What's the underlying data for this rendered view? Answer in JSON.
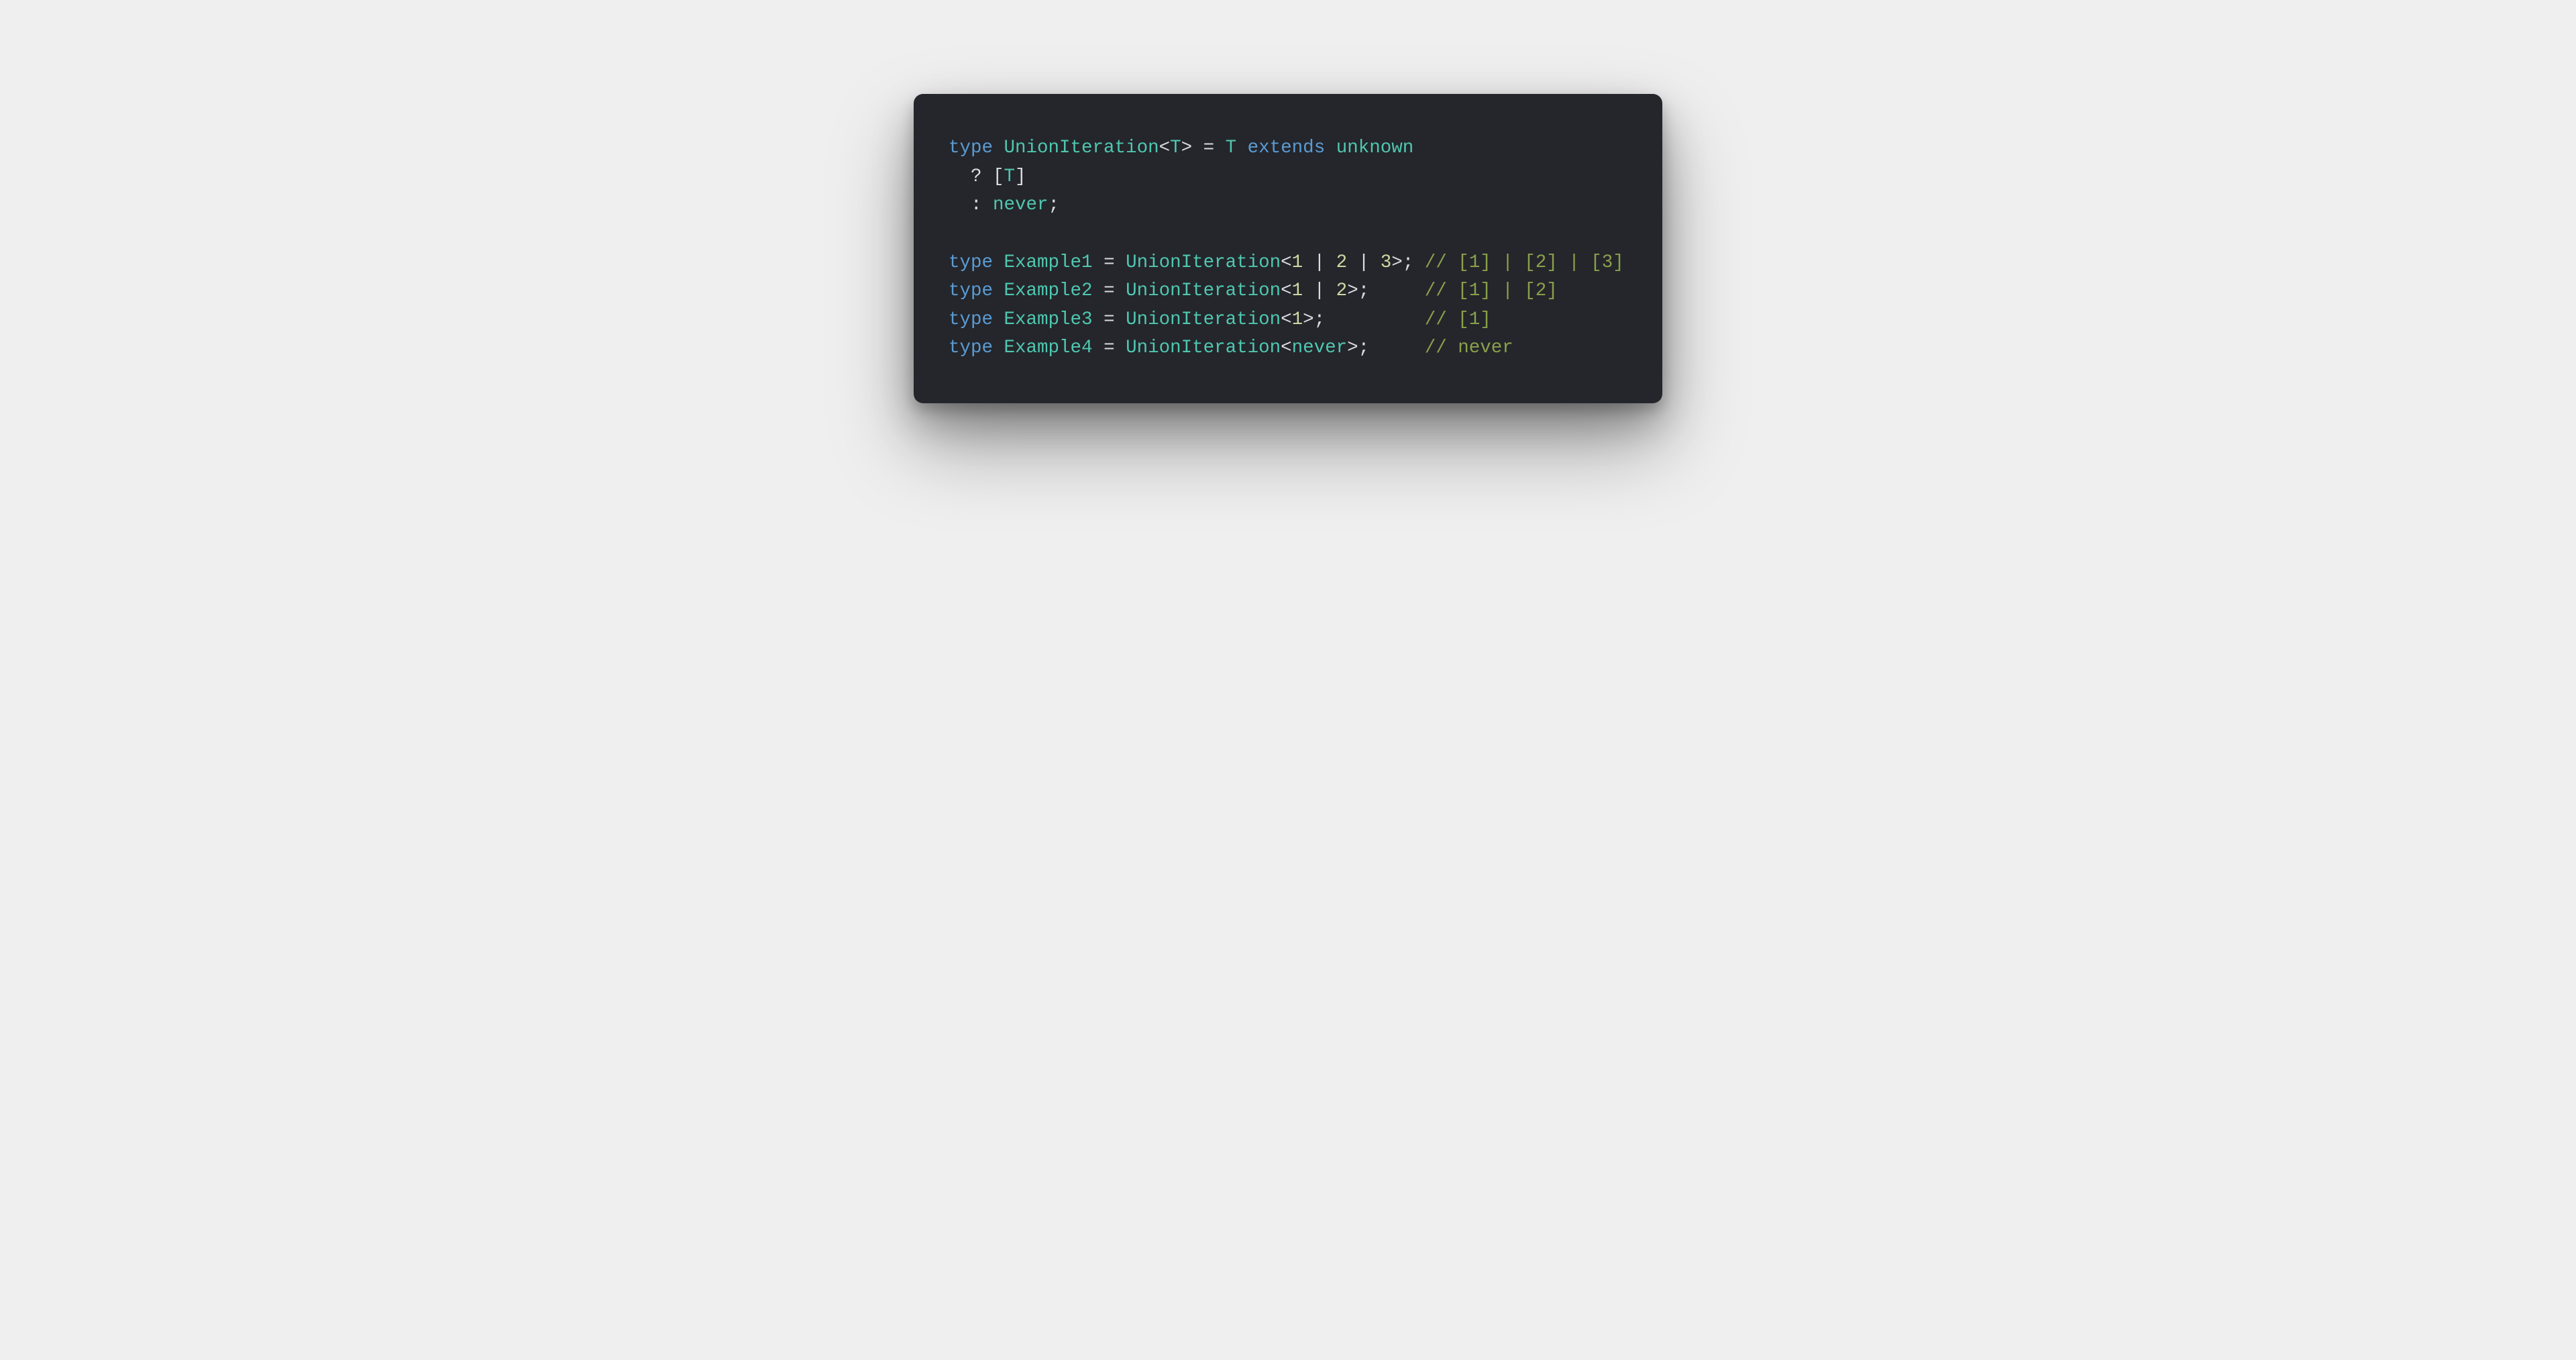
{
  "code": {
    "tokens": [
      [
        {
          "t": "type",
          "c": "tok-keyword"
        },
        {
          "t": " ",
          "c": "tok-punct"
        },
        {
          "t": "UnionIteration",
          "c": "tok-typename"
        },
        {
          "t": "<",
          "c": "tok-punct"
        },
        {
          "t": "T",
          "c": "tok-typename"
        },
        {
          "t": ">",
          "c": "tok-punct"
        },
        {
          "t": " = ",
          "c": "tok-punct"
        },
        {
          "t": "T",
          "c": "tok-typename"
        },
        {
          "t": " ",
          "c": "tok-punct"
        },
        {
          "t": "extends",
          "c": "tok-keyword"
        },
        {
          "t": " ",
          "c": "tok-punct"
        },
        {
          "t": "unknown",
          "c": "tok-typename"
        }
      ],
      [
        {
          "t": "  ? [",
          "c": "tok-punct"
        },
        {
          "t": "T",
          "c": "tok-typename"
        },
        {
          "t": "]",
          "c": "tok-punct"
        }
      ],
      [
        {
          "t": "  : ",
          "c": "tok-punct"
        },
        {
          "t": "never",
          "c": "tok-typename"
        },
        {
          "t": ";",
          "c": "tok-punct"
        }
      ],
      [],
      [
        {
          "t": "type",
          "c": "tok-keyword"
        },
        {
          "t": " ",
          "c": "tok-punct"
        },
        {
          "t": "Example1",
          "c": "tok-typename"
        },
        {
          "t": " = ",
          "c": "tok-punct"
        },
        {
          "t": "UnionIteration",
          "c": "tok-typename"
        },
        {
          "t": "<",
          "c": "tok-punct"
        },
        {
          "t": "1",
          "c": "tok-number"
        },
        {
          "t": " | ",
          "c": "tok-punct"
        },
        {
          "t": "2",
          "c": "tok-number"
        },
        {
          "t": " | ",
          "c": "tok-punct"
        },
        {
          "t": "3",
          "c": "tok-number"
        },
        {
          "t": ">;",
          "c": "tok-punct"
        },
        {
          "t": " ",
          "c": "tok-punct"
        },
        {
          "t": "// [1] | [2] | [3]",
          "c": "tok-comment"
        }
      ],
      [
        {
          "t": "type",
          "c": "tok-keyword"
        },
        {
          "t": " ",
          "c": "tok-punct"
        },
        {
          "t": "Example2",
          "c": "tok-typename"
        },
        {
          "t": " = ",
          "c": "tok-punct"
        },
        {
          "t": "UnionIteration",
          "c": "tok-typename"
        },
        {
          "t": "<",
          "c": "tok-punct"
        },
        {
          "t": "1",
          "c": "tok-number"
        },
        {
          "t": " | ",
          "c": "tok-punct"
        },
        {
          "t": "2",
          "c": "tok-number"
        },
        {
          "t": ">;",
          "c": "tok-punct"
        },
        {
          "t": "     ",
          "c": "tok-punct"
        },
        {
          "t": "// [1] | [2]",
          "c": "tok-comment"
        }
      ],
      [
        {
          "t": "type",
          "c": "tok-keyword"
        },
        {
          "t": " ",
          "c": "tok-punct"
        },
        {
          "t": "Example3",
          "c": "tok-typename"
        },
        {
          "t": " = ",
          "c": "tok-punct"
        },
        {
          "t": "UnionIteration",
          "c": "tok-typename"
        },
        {
          "t": "<",
          "c": "tok-punct"
        },
        {
          "t": "1",
          "c": "tok-number"
        },
        {
          "t": ">;",
          "c": "tok-punct"
        },
        {
          "t": "         ",
          "c": "tok-punct"
        },
        {
          "t": "// [1]",
          "c": "tok-comment"
        }
      ],
      [
        {
          "t": "type",
          "c": "tok-keyword"
        },
        {
          "t": " ",
          "c": "tok-punct"
        },
        {
          "t": "Example4",
          "c": "tok-typename"
        },
        {
          "t": " = ",
          "c": "tok-punct"
        },
        {
          "t": "UnionIteration",
          "c": "tok-typename"
        },
        {
          "t": "<",
          "c": "tok-punct"
        },
        {
          "t": "never",
          "c": "tok-typename"
        },
        {
          "t": ">;",
          "c": "tok-punct"
        },
        {
          "t": "     ",
          "c": "tok-punct"
        },
        {
          "t": "// never",
          "c": "tok-comment"
        }
      ]
    ]
  }
}
